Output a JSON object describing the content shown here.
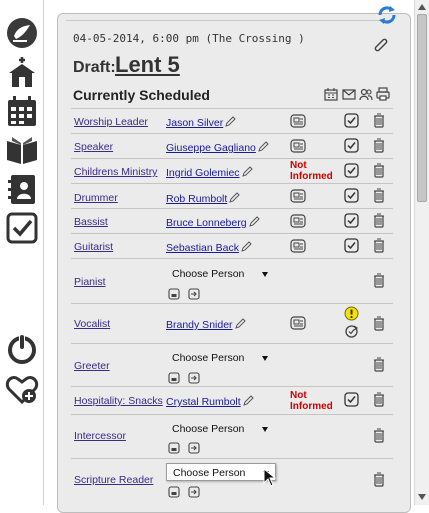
{
  "header": {
    "date": "04-05-2014, 6:00 pm (The Crossing )",
    "draft_label": "Draft:",
    "draft_title": "Lent 5",
    "section_title": "Currently Scheduled"
  },
  "nav": {
    "items": [
      "dashboard-icon",
      "church-icon",
      "calendar-icon",
      "bible-icon",
      "contacts-icon",
      "checklist-icon",
      "power-icon",
      "heart-plus-icon"
    ]
  },
  "schedule": {
    "rows": [
      {
        "role": "Worship Leader",
        "person": "Jason Silver",
        "status": "",
        "confirmed": true
      },
      {
        "role": "Speaker",
        "person": "Giuseppe Gagliano",
        "status": "",
        "confirmed": true
      },
      {
        "role": "Childrens Ministry",
        "person": "Ingrid Golemiec",
        "status": "Not Informed",
        "confirmed": true
      },
      {
        "role": "Drummer",
        "person": "Rob Rumbolt",
        "status": "",
        "confirmed": true
      },
      {
        "role": "Bassist",
        "person": "Bruce Lonneberg",
        "status": "",
        "confirmed": true
      },
      {
        "role": "Guitarist",
        "person": "Sebastian Back",
        "status": "",
        "confirmed": true
      },
      {
        "role": "Pianist",
        "person": "",
        "chooser": "Choose Person"
      },
      {
        "role": "Vocalist",
        "person": "Brandy Snider",
        "status": "",
        "pending": true
      },
      {
        "role": "Greeter",
        "person": "",
        "chooser": "Choose Person"
      },
      {
        "role": "Hospitality: Snacks",
        "person": "Crystal Rumbolt",
        "status": "Not Informed",
        "confirmed": true
      },
      {
        "role": "Intercessor",
        "person": "",
        "chooser": "Choose Person"
      },
      {
        "role": "Scripture Reader",
        "person": "",
        "chooser": "Choose Person",
        "open": true
      }
    ]
  }
}
